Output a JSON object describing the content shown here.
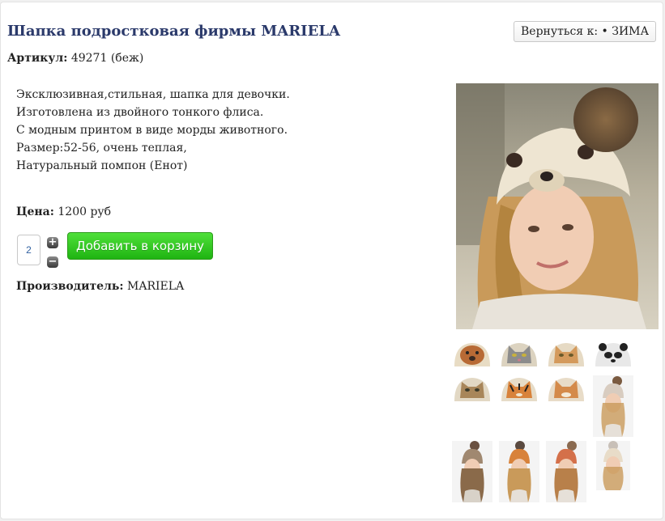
{
  "product": {
    "title": "Шапка подростковая фирмы MARIELA",
    "back_button": "Вернуться к: • ЗИМА",
    "sku_label": "Артикул:",
    "sku_value": "49271 (беж)",
    "description": [
      "Эксклюзивная,стильная, шапка для девочки.",
      "Изготовлена из двойного тонкого флиса.",
      "С модным принтом в виде морды животного.",
      "Размер:52-56, очень теплая,",
      "Натуральный помпон (Енот)"
    ],
    "price_label": "Цена:",
    "price_value": "1200 руб",
    "quantity": "2",
    "add_to_cart": "Добавить в корзину",
    "manufacturer_label": "Производитель:",
    "manufacturer_value": "MARIELA"
  },
  "gallery": {
    "main_image": "girl-in-bear-hat-photo",
    "thumbnails": [
      "dog-hat",
      "cat-hat",
      "tan-cat-hat",
      "panda-hat",
      "tabby-cat-hat",
      "tiger-hat",
      "fox-hat",
      "girl-photo",
      "girl-photo",
      "girl-photo",
      "girl-photo",
      "girl-photo"
    ]
  },
  "colors": {
    "title": "#2b3a6b",
    "add_button": "#26c118"
  }
}
